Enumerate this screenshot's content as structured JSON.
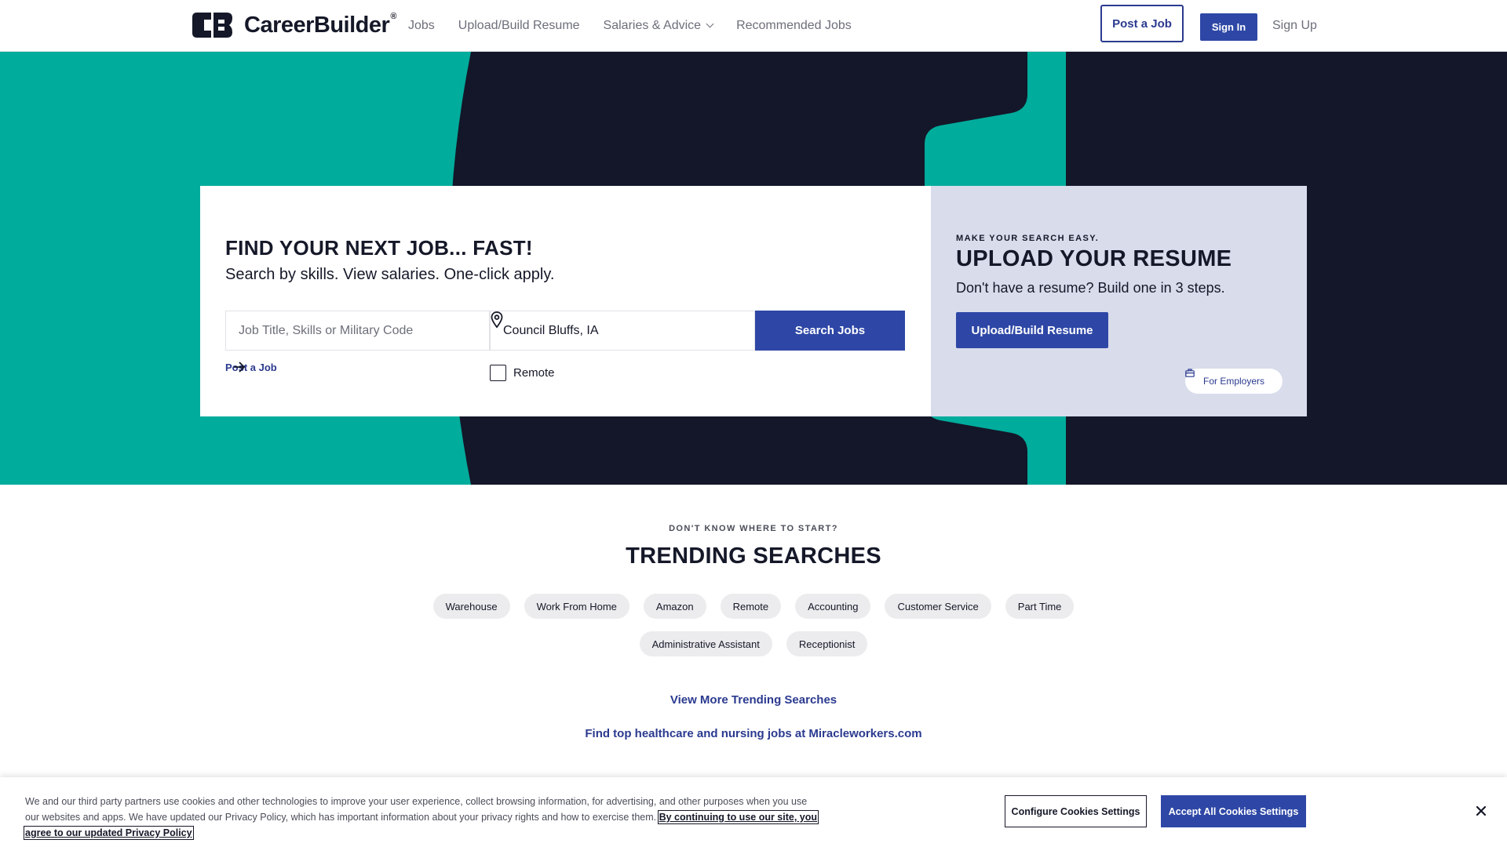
{
  "brand": {
    "name": "CareerBuilder",
    "mark": "®"
  },
  "nav": {
    "items": [
      {
        "label": "Jobs"
      },
      {
        "label": "Upload/Build Resume"
      },
      {
        "label": "Salaries & Advice",
        "has_dropdown": true
      },
      {
        "label": "Recommended Jobs"
      }
    ],
    "post_job_label": "Post a Job",
    "sign_in_label": "Sign In",
    "sign_up_label": "Sign Up"
  },
  "hero": {
    "headline": "FIND YOUR NEXT JOB... FAST!",
    "subheadline": "Search by skills. View salaries. One-click apply.",
    "job_input": {
      "placeholder": "Job Title, Skills or Military Code",
      "value": ""
    },
    "location_input": {
      "value": "Council Bluffs, IA"
    },
    "search_button": "Search Jobs",
    "post_job_link": "Post a Job",
    "remote_label": "Remote",
    "remote_checked": false,
    "upload": {
      "eyebrow": "MAKE YOUR SEARCH EASY.",
      "title": "UPLOAD YOUR RESUME",
      "subtitle": "Don't have a resume? Build one in 3 steps.",
      "button": "Upload/Build Resume"
    },
    "employers_pill": "For Employers"
  },
  "trending": {
    "eyebrow": "DON'T KNOW WHERE TO START?",
    "title": "TRENDING SEARCHES",
    "pills": [
      "Warehouse",
      "Work From Home",
      "Amazon",
      "Remote",
      "Accounting",
      "Customer Service",
      "Part Time",
      "Administrative Assistant",
      "Receptionist"
    ],
    "view_more": "View More Trending Searches",
    "healthcare_link": "Find top healthcare and nursing jobs at Miracleworkers.com"
  },
  "cookie": {
    "text": "We and our third party partners use cookies and other technologies to improve your user experience, collect browsing information, for advertising, and other purposes when you use our websites and apps. We have updated our Privacy Policy, which has important information about your privacy rights and how to exercise them.",
    "link_text": "By continuing to use our site, you agree to our updated Privacy Policy",
    "configure_button": "Configure Cookies Settings",
    "accept_button": "Accept All Cookies Settings"
  },
  "colors": {
    "teal": "#00ac9c",
    "navy": "#141729",
    "primary_blue": "#2e47a6",
    "upload_panel": "#d8dceb",
    "pill_bg": "#ececee"
  },
  "icons": [
    "logo-mark-icon",
    "chevron-down-icon",
    "location-pin-icon",
    "arrow-right-icon",
    "briefcase-icon",
    "close-icon"
  ]
}
